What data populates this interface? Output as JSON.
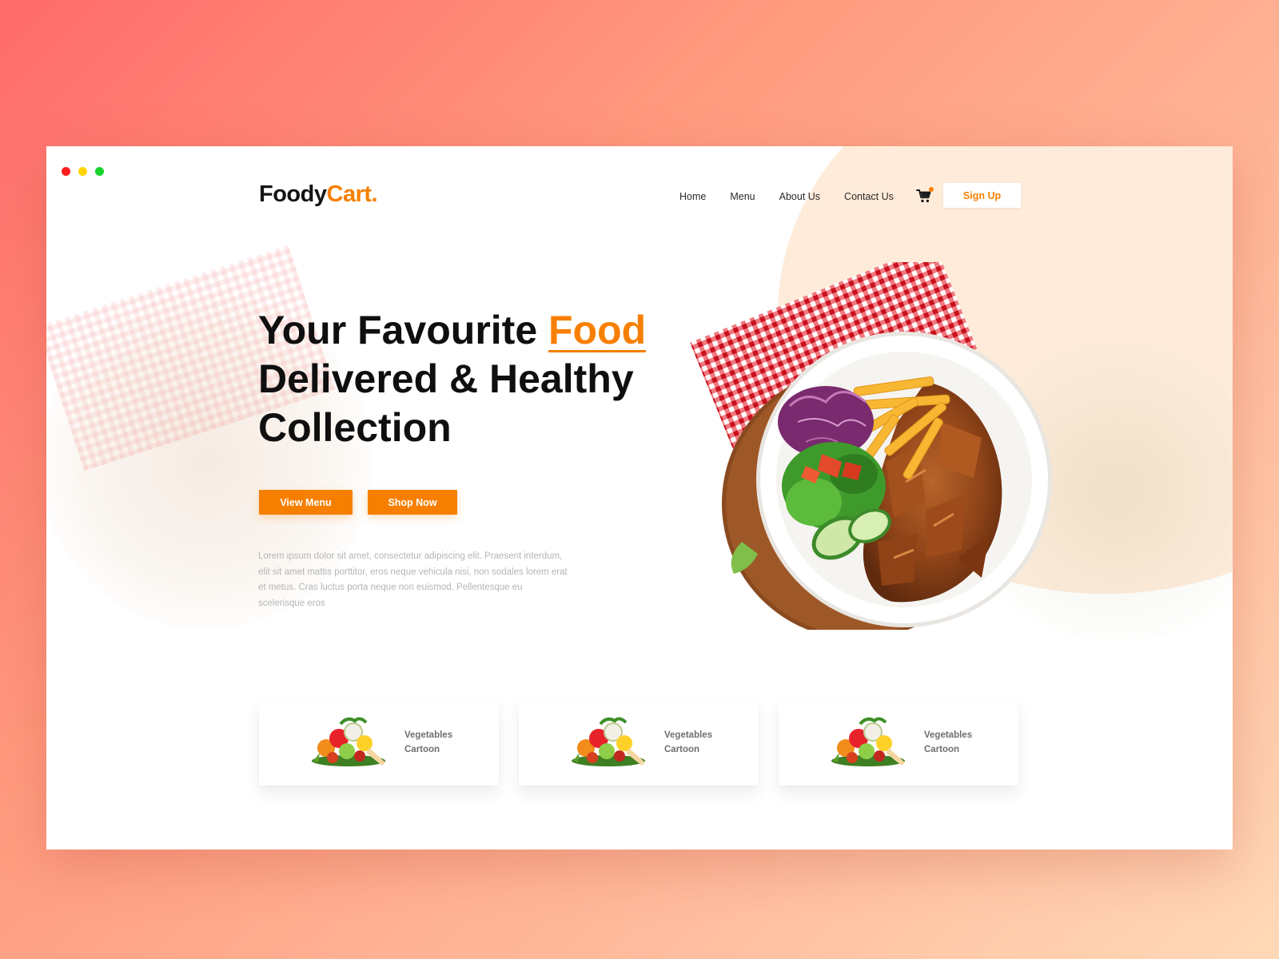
{
  "window": {
    "controls": [
      "close",
      "minimize",
      "maximize"
    ]
  },
  "logo": {
    "main": "Foody",
    "accent": "Cart."
  },
  "nav": {
    "links": [
      "Home",
      "Menu",
      "About Us",
      "Contact Us"
    ],
    "cart_icon": "cart-icon",
    "signup_label": "Sign Up"
  },
  "hero": {
    "title_line1_prefix": "Your Favourite ",
    "title_highlight": "Food",
    "title_line2": "Delivered & Healthy",
    "title_line3": "Collection",
    "view_menu_label": "View Menu",
    "shop_now_label": "Shop Now",
    "description": "Lorem ipsum dolor sit amet, consectetur adipiscing elit. Praesent interdum, elit sit amet mattis porttitor, eros neque vehicula nisi, non sodales lorem erat et metus. Cras luctus porta neque non euismod. Pellentesque eu scelerisque eros"
  },
  "cards": [
    {
      "line1": "Vegetables",
      "line2": "Cartoon",
      "icon": "vegetables-image"
    },
    {
      "line1": "Vegetables",
      "line2": "Cartoon",
      "icon": "vegetables-image"
    },
    {
      "line1": "Vegetables",
      "line2": "Cartoon",
      "icon": "vegetables-image"
    }
  ],
  "colors": {
    "accent": "#f77f00",
    "peach": "#ffebd9",
    "text_dark": "#0f0f0f",
    "text_muted": "#b5b5b5"
  }
}
